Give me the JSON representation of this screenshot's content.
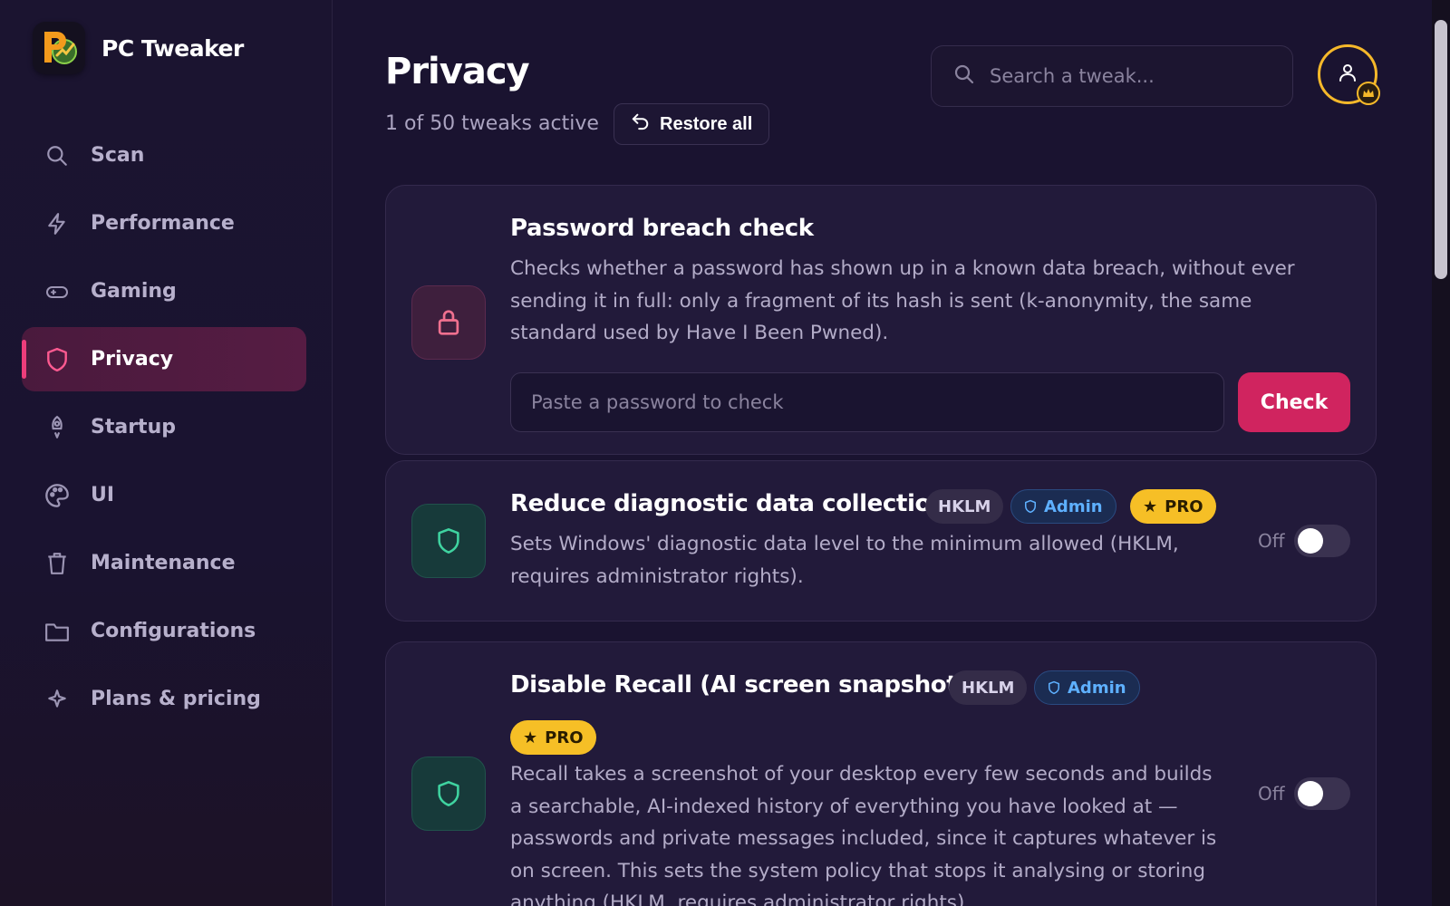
{
  "app": {
    "name": "PC Tweaker"
  },
  "sidebar": {
    "items": [
      {
        "label": "Scan",
        "icon": "search-icon"
      },
      {
        "label": "Performance",
        "icon": "bolt-icon"
      },
      {
        "label": "Gaming",
        "icon": "gamepad-icon"
      },
      {
        "label": "Privacy",
        "icon": "shield-icon",
        "active": true
      },
      {
        "label": "Startup",
        "icon": "rocket-icon"
      },
      {
        "label": "UI",
        "icon": "palette-icon"
      },
      {
        "label": "Maintenance",
        "icon": "trash-icon"
      },
      {
        "label": "Configurations",
        "icon": "folder-icon"
      },
      {
        "label": "Plans & pricing",
        "icon": "sparkle-icon"
      }
    ]
  },
  "header": {
    "title": "Privacy",
    "count_text": "1 of 50 tweaks active",
    "restore_label": "Restore all",
    "search_placeholder": "Search a tweak..."
  },
  "password_check": {
    "title": "Password breach check",
    "description": "Checks whether a password has shown up in a known data breach, without ever sending it in full: only a fragment of its hash is sent (k-anonymity, the same standard used by Have I Been Pwned).",
    "input_placeholder": "Paste a password to check",
    "button_label": "Check"
  },
  "tweaks": [
    {
      "title": "Reduce diagnostic data collection",
      "badges": {
        "hklm": "HKLM",
        "admin": "Admin",
        "pro": "PRO"
      },
      "description": "Sets Windows' diagnostic data level to the minimum allowed (HKLM, requires administrator rights).",
      "toggle_label": "Off",
      "enabled": false
    },
    {
      "title": "Disable Recall (AI screen snapshots)",
      "badges": {
        "hklm": "HKLM",
        "admin": "Admin",
        "pro": "PRO"
      },
      "description": "Recall takes a screenshot of your desktop every few seconds and builds a searchable, AI-indexed history of everything you have looked at — passwords and private messages included, since it captures whatever is on screen. This sets the system policy that stops it analysing or storing anything (HKLM, requires administrator rights).",
      "toggle_label": "Off",
      "enabled": false
    }
  ],
  "colors": {
    "accent": "#d0245f",
    "pro_badge": "#f6bf26",
    "admin_badge_text": "#5eb0ff",
    "background": "#1a1330"
  }
}
